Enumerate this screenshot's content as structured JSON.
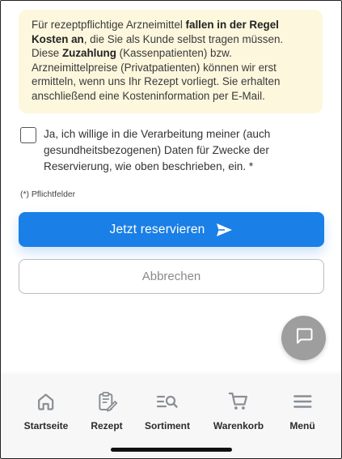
{
  "info": {
    "t1": "Für rezeptpflichtige Arzneimittel ",
    "b1": "fallen in der Regel Kosten an",
    "t2": ", die Sie als Kunde selbst tragen müssen. Diese ",
    "b2": "Zuzahlung",
    "t3": " (Kassenpatienten) bzw. Arzneimittelpreise (Privatpatienten) können wir erst ermitteln, wenn uns Ihr Rezept vorliegt. Sie erhalten anschließend eine Kosteninformation per E-Mail."
  },
  "consent": {
    "label": "Ja, ich willige in die Verarbeitung meiner (auch gesundheitsbezogenen) Daten für Zwecke der Reservierung, wie oben beschrieben, ein. *",
    "checked": false
  },
  "required_note": "(*) Pflichtfelder",
  "actions": {
    "reserve_label": "Jetzt reservieren",
    "cancel_label": "Abbrechen"
  },
  "chat": {
    "icon": "chat-icon"
  },
  "nav": {
    "items": [
      {
        "label": "Startseite",
        "icon": "home-icon"
      },
      {
        "label": "Rezept",
        "icon": "prescription-icon"
      },
      {
        "label": "Sortiment",
        "icon": "search-list-icon"
      },
      {
        "label": "Warenkorb",
        "icon": "cart-icon"
      },
      {
        "label": "Menü",
        "icon": "menu-icon"
      }
    ]
  },
  "colors": {
    "primary": "#1a7fe6",
    "info_background": "#fdf7dd",
    "fab": "#9e9e9e",
    "nav_icon": "#8a8f96"
  }
}
